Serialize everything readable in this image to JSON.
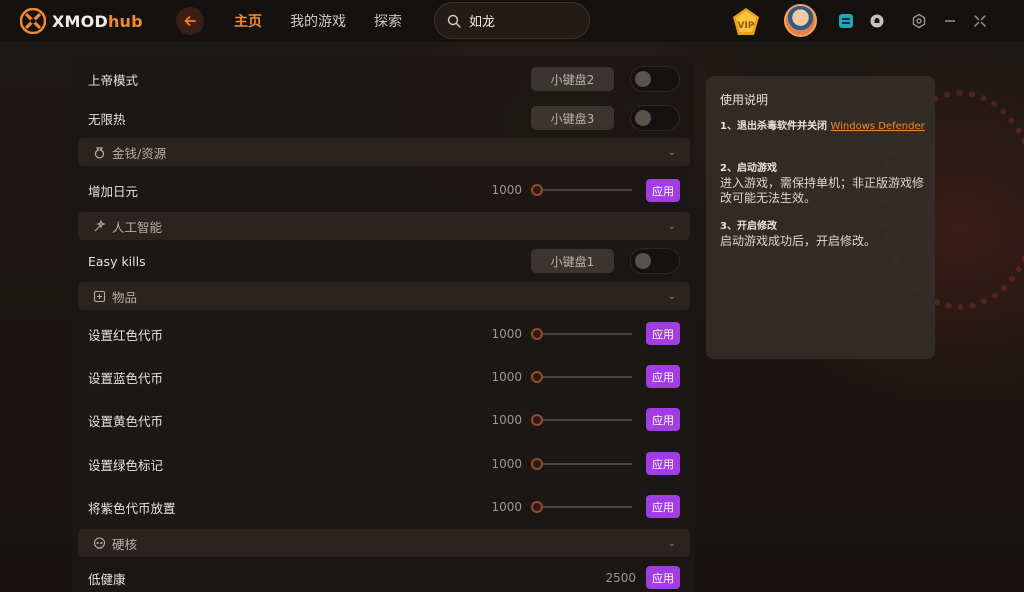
{
  "app": {
    "brand_main": "XMOD",
    "brand_hub": "hub"
  },
  "nav": {
    "home": "主页",
    "my_games": "我的游戏",
    "explore": "探索"
  },
  "search": {
    "value": "如龙"
  },
  "colors": {
    "accent": "#f58a2c",
    "apply": "#a23de3",
    "link": "#f08a2a"
  },
  "list": {
    "god_mode": {
      "label": "上帝模式",
      "key": "小键盘2"
    },
    "no_heat": {
      "label": "无限热",
      "key": "小键盘3"
    },
    "section_money": "金钱/资源",
    "add_yen": {
      "label": "增加日元",
      "value": "1000",
      "apply": "应用"
    },
    "section_ai": "人工智能",
    "easy_kills": {
      "label": "Easy kills",
      "key": "小键盘1"
    },
    "section_items": "物品",
    "red_token": {
      "label": "设置红色代币",
      "value": "1000",
      "apply": "应用"
    },
    "blue_token": {
      "label": "设置蓝色代币",
      "value": "1000",
      "apply": "应用"
    },
    "yellow_token": {
      "label": "设置黄色代币",
      "value": "1000",
      "apply": "应用"
    },
    "green_mark": {
      "label": "设置绿色标记",
      "value": "1000",
      "apply": "应用"
    },
    "purple_token": {
      "label": "将紫色代币放置",
      "value": "1000",
      "apply": "应用"
    },
    "section_hardcore": "硬核",
    "low_health": {
      "label": "低健康",
      "value": "2500",
      "apply": "应用"
    }
  },
  "instructions": {
    "title": "使用说明",
    "step1_head": "1、退出杀毒软件并关闭",
    "step1_link": "Windows Defender",
    "step2_head": "2、启动游戏",
    "step2_body": "进入游戏，需保持单机；非正版游戏修改可能无法生效。",
    "step3_head": "3、开启修改",
    "step3_body": "启动游戏成功后，开启修改。"
  }
}
